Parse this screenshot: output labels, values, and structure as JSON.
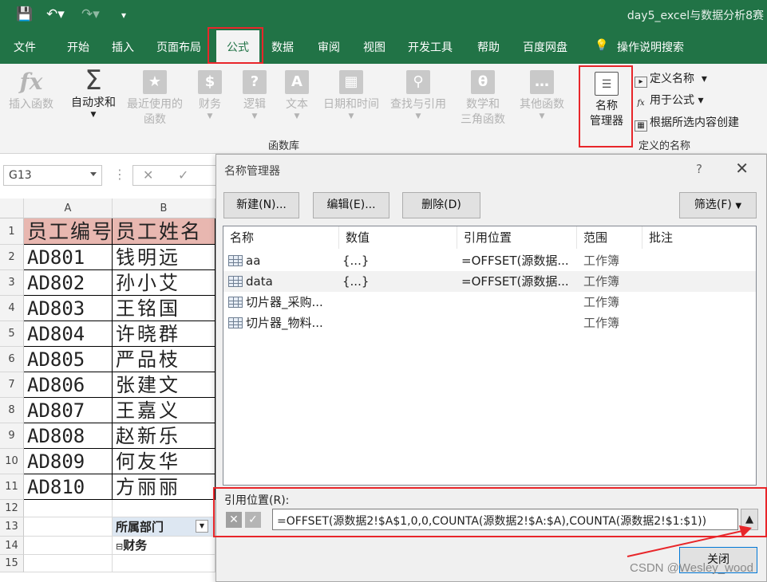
{
  "window": {
    "title": "day5_excel与数据分析8赛"
  },
  "menu": {
    "tabs": [
      "文件",
      "开始",
      "插入",
      "页面布局",
      "公式",
      "数据",
      "审阅",
      "视图",
      "开发工具",
      "帮助",
      "百度网盘",
      "操作说明搜索"
    ],
    "active": "公式"
  },
  "ribbon": {
    "insert_function": "插入函数",
    "autosum": "自动求和",
    "recent": [
      "最近使用的",
      "函数"
    ],
    "finance": "财务",
    "logic": "逻辑",
    "text": "文本",
    "datetime": "日期和时间",
    "lookup": "查找与引用",
    "math": [
      "数学和",
      "三角函数"
    ],
    "other": "其他函数",
    "library_label": "函数库",
    "name_manager": [
      "名称",
      "管理器"
    ],
    "define_name": "定义名称",
    "use_in_formula": "用于公式",
    "create_from_selection": "根据所选内容创建",
    "defined_names_label": "定义的名称"
  },
  "formula_bar": {
    "name_box": "G13"
  },
  "sheet": {
    "columns": [
      "A",
      "B"
    ],
    "rows": [
      "1",
      "2",
      "3",
      "4",
      "5",
      "6",
      "7",
      "8",
      "9",
      "10",
      "11",
      "12",
      "13",
      "14",
      "15"
    ],
    "header": [
      "员工编号",
      "员工姓名"
    ],
    "data": [
      [
        "AD801",
        "钱明远"
      ],
      [
        "AD802",
        "孙小艾"
      ],
      [
        "AD803",
        "王铭国"
      ],
      [
        "AD804",
        "许晓群"
      ],
      [
        "AD805",
        "严品枝"
      ],
      [
        "AD806",
        "张建文"
      ],
      [
        "AD807",
        "王嘉义"
      ],
      [
        "AD808",
        "赵新乐"
      ],
      [
        "AD809",
        "何友华"
      ],
      [
        "AD810",
        "方丽丽"
      ]
    ],
    "pivot_label": "所属部门",
    "pivot_item": "财务"
  },
  "dialog": {
    "title": "名称管理器",
    "help": "?",
    "new_button": "新建(N)...",
    "edit_button": "编辑(E)...",
    "delete_button": "删除(D)",
    "filter_button": "筛选(F)",
    "columns": [
      "名称",
      "数值",
      "引用位置",
      "范围",
      "批注"
    ],
    "rows": [
      {
        "name": "aa",
        "value": "{...}",
        "ref": "=OFFSET(源数据...",
        "scope": "工作簿"
      },
      {
        "name": "data",
        "value": "{...}",
        "ref": "=OFFSET(源数据...",
        "scope": "工作簿"
      },
      {
        "name": "切片器_采购...",
        "value": "",
        "ref": "",
        "scope": "工作簿"
      },
      {
        "name": "切片器_物料...",
        "value": "",
        "ref": "",
        "scope": "工作簿"
      }
    ],
    "ref_label": "引用位置(R):",
    "ref_value": "=OFFSET(源数据2!$A$1,0,0,COUNTA(源数据2!$A:$A),COUNTA(源数据2!$1:$1))",
    "close_button": "关闭"
  },
  "watermark": "CSDN @Wesley_wood",
  "colors": {
    "excel_green": "#217346",
    "highlight_red": "#e8262a",
    "header_fill": "#e8b7b0"
  }
}
